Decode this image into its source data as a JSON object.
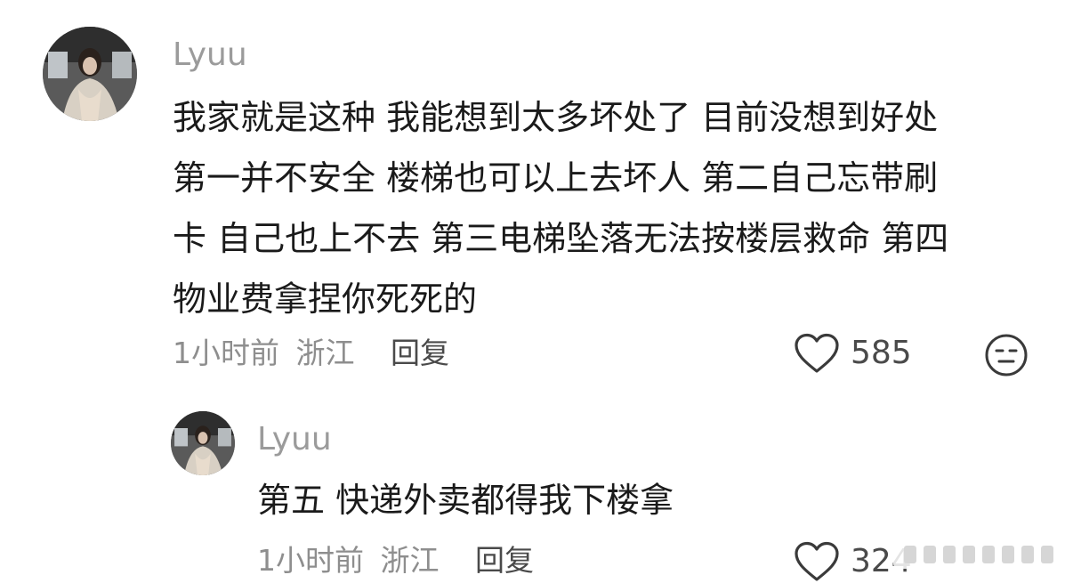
{
  "comments": [
    {
      "username": "Lyuu",
      "text": "我家就是这种 我能想到太多坏处了 目前没想到好处\n第一并不安全 楼梯也可以上去坏人 第二自己忘带刷\n卡 自己也上不去 第三电梯坠落无法按楼层救命 第四\n物业费拿捏你死死的",
      "time": "1小时前",
      "location": "浙江",
      "reply_label": "回复",
      "likes": "585"
    },
    {
      "username": "Lyuu",
      "text": "第五 快递外卖都得我下楼拿",
      "time": "1小时前",
      "location": "浙江",
      "reply_label": "回复",
      "likes": "324"
    }
  ],
  "icons": {
    "like": "heart-outline-icon",
    "dislike": "neutral-face-icon"
  }
}
